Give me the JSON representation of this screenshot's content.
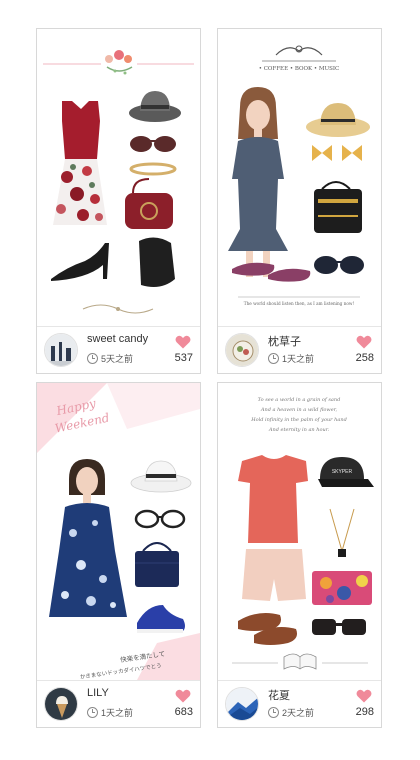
{
  "accent_color": "#f08a9a",
  "cards": [
    {
      "username": "sweet candy",
      "time": "5天之前",
      "likes": "537",
      "icons": [
        "clock-icon",
        "heart-icon"
      ]
    },
    {
      "username": "枕草子",
      "time": "1天之前",
      "likes": "258",
      "header_text": "• COFFEE • BOOK • MUSIC",
      "quote": "The world should listen then, as I am listening now!",
      "icons": [
        "clock-icon",
        "heart-icon"
      ]
    },
    {
      "username": "LILY",
      "time": "1天之前",
      "likes": "683",
      "title_line1": "Happy",
      "title_line2": "Weekend",
      "jp_line1": "快楽を満たして",
      "jp_line2": "かきまないドッカダイハツでとう",
      "icons": [
        "clock-icon",
        "heart-icon"
      ]
    },
    {
      "username": "花夏",
      "time": "2天之前",
      "likes": "298",
      "poem": [
        "To see a world in a grain of sand",
        "And a heaven in a wild flower,",
        "Hold infinity in the palm of your hand",
        "And eternity in an hour."
      ],
      "cap_text": "SKYPER",
      "icons": [
        "clock-icon",
        "heart-icon"
      ]
    }
  ]
}
